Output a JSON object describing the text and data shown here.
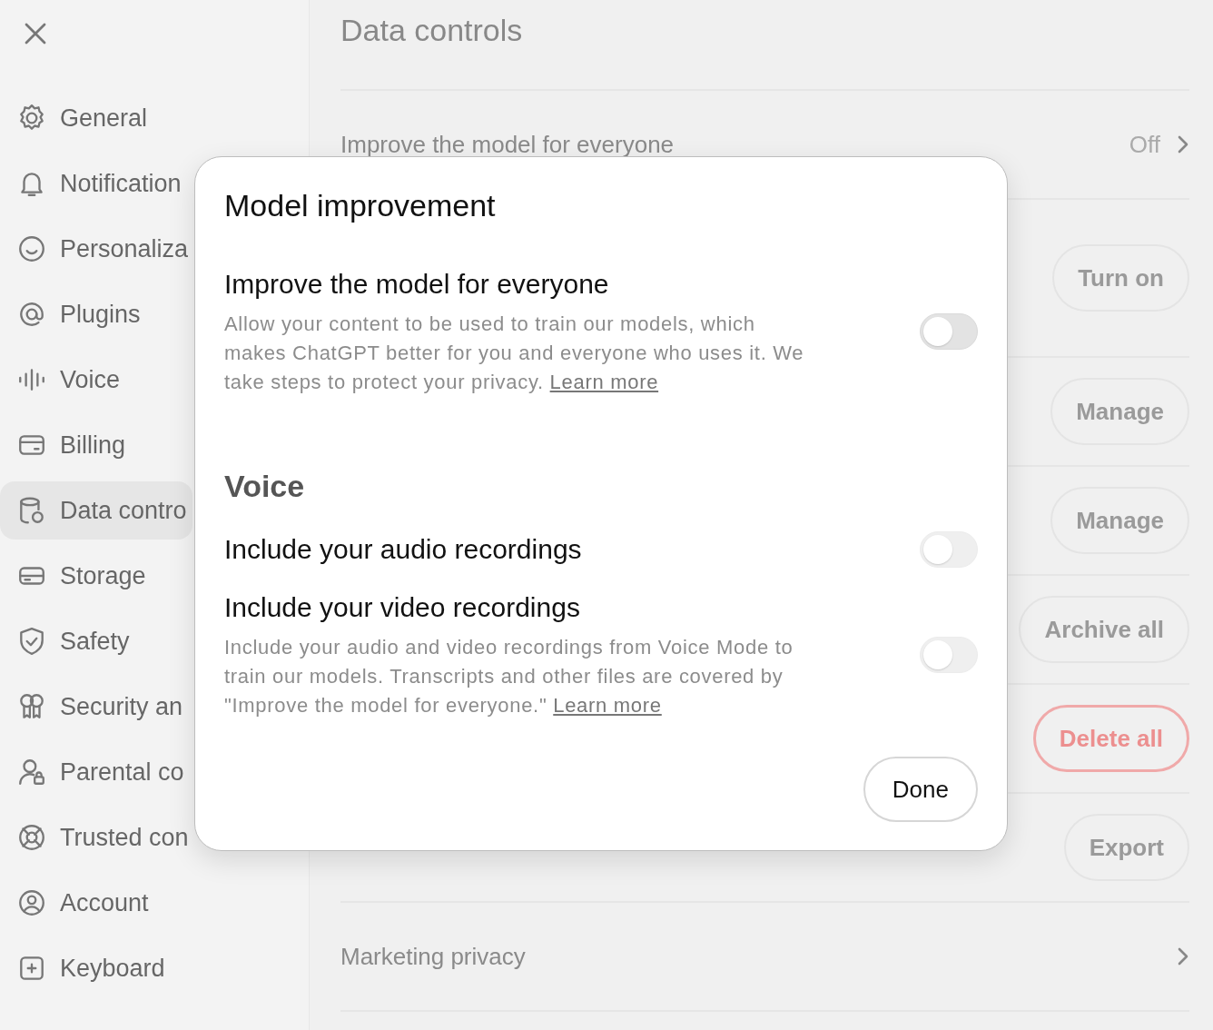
{
  "sidebar": {
    "items": [
      {
        "label": "General",
        "selected": false
      },
      {
        "label": "Notification",
        "selected": false
      },
      {
        "label": "Personaliza",
        "selected": false
      },
      {
        "label": "Plugins",
        "selected": false
      },
      {
        "label": "Voice",
        "selected": false
      },
      {
        "label": "Billing",
        "selected": false
      },
      {
        "label": "Data contro",
        "selected": true
      },
      {
        "label": "Storage",
        "selected": false
      },
      {
        "label": "Safety",
        "selected": false
      },
      {
        "label": "Security an",
        "selected": false
      },
      {
        "label": "Parental co",
        "selected": false
      },
      {
        "label": "Trusted con",
        "selected": false
      },
      {
        "label": "Account",
        "selected": false
      },
      {
        "label": "Keyboard",
        "selected": false
      }
    ]
  },
  "panel": {
    "title": "Data controls",
    "rows": [
      {
        "kind": "link",
        "label": "Improve the model for everyone",
        "value": "Off"
      },
      {
        "kind": "button",
        "button": "Turn on"
      },
      {
        "kind": "button",
        "button": "Manage"
      },
      {
        "kind": "button",
        "button": "Manage"
      },
      {
        "kind": "button",
        "button": "Archive all"
      },
      {
        "kind": "danger",
        "button": "Delete all"
      },
      {
        "kind": "button",
        "button": "Export"
      },
      {
        "kind": "link",
        "label": "Marketing privacy"
      }
    ]
  },
  "dialog": {
    "title": "Model improvement",
    "sections": [
      {
        "items": [
          {
            "title": "Improve the model for everyone",
            "description": "Allow your content to be used to train our models, which makes ChatGPT better for you and everyone who uses it. We take steps to protect your privacy.",
            "link": "Learn more",
            "on": false,
            "disabled": false
          }
        ]
      },
      {
        "heading": "Voice",
        "items": [
          {
            "title": "Include your audio recordings",
            "on": false,
            "disabled": true
          },
          {
            "title": "Include your video recordings",
            "description": "Include your audio and video recordings from Voice Mode to train our models. Transcripts and other files are covered by \"Improve the model for everyone.\"",
            "link": "Learn more",
            "on": false,
            "disabled": true
          }
        ]
      }
    ],
    "done": "Done"
  }
}
